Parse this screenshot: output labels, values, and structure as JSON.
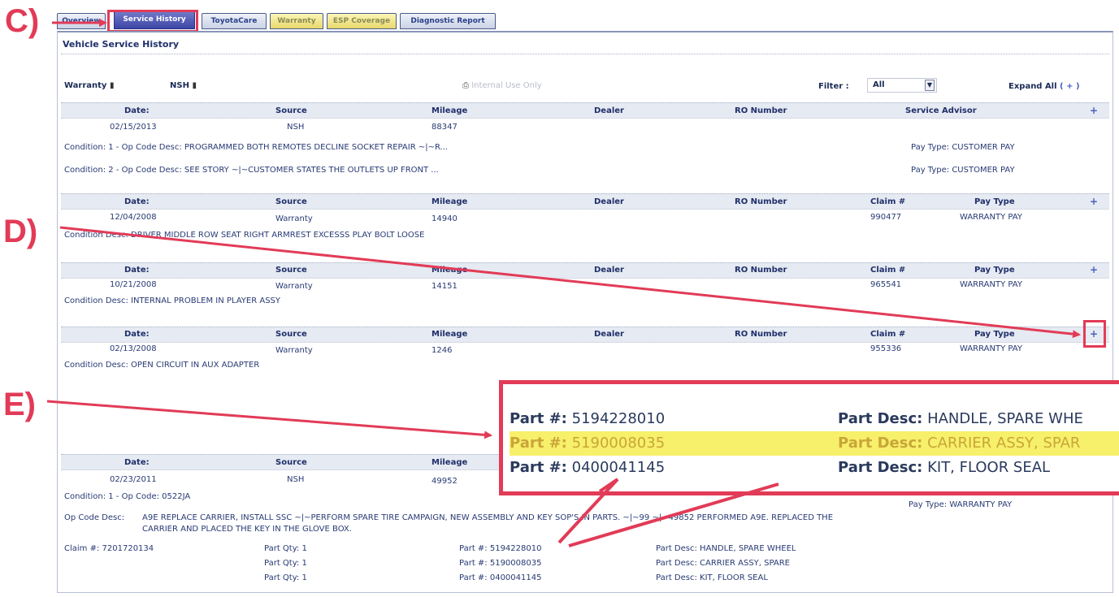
{
  "callouts": {
    "c": "C)",
    "d": "D)",
    "e": "E)"
  },
  "tabs": [
    {
      "label": "Overview",
      "state": "normal"
    },
    {
      "label": "Service History",
      "state": "active"
    },
    {
      "label": "ToyotaCare",
      "state": "normal"
    },
    {
      "label": "Warranty",
      "state": "yellow"
    },
    {
      "label": "ESP Coverage",
      "state": "yellow"
    },
    {
      "label": "Diagnostic Report",
      "state": "normal"
    }
  ],
  "panel_title": "Vehicle Service History",
  "legend": {
    "warranty": "Warranty",
    "nsh": "NSH",
    "center_text": "Internal Use Only"
  },
  "filter": {
    "label": "Filter :",
    "value": "All"
  },
  "expand_all": "Expand All",
  "expand_symbol": "( + )",
  "plus_symbol": "+",
  "column_labels": {
    "date": "Date:",
    "source": "Source",
    "mileage": "Mileage",
    "dealer": "Dealer",
    "ro_number": "RO Number",
    "service_advisor": "Service Advisor",
    "claim": "Claim #",
    "pay_type": "Pay Type"
  },
  "records": [
    {
      "date": "02/15/2013",
      "source": "NSH",
      "mileage": "88347",
      "lines": [
        {
          "text": "Condition: 1 - Op Code Desc: PROGRAMMED BOTH REMOTES DECLINE SOCKET REPAIR ~|~R...",
          "pay": "Pay Type: CUSTOMER PAY"
        },
        {
          "text": "Condition: 2 - Op Code Desc: SEE STORY ~|~CUSTOMER STATES THE OUTLETS UP FRONT ...",
          "pay": "Pay Type: CUSTOMER PAY"
        }
      ]
    },
    {
      "date": "12/04/2008",
      "source": "Warranty",
      "mileage": "14940",
      "claim": "990477",
      "pay_type": "WARRANTY PAY",
      "desc": "Condition Desc: DRIVER MIDDLE ROW SEAT RIGHT ARMREST EXCESSS PLAY BOLT LOOSE"
    },
    {
      "date": "10/21/2008",
      "source": "Warranty",
      "mileage": "14151",
      "claim": "965541",
      "pay_type": "WARRANTY PAY",
      "desc": "Condition Desc: INTERNAL PROBLEM IN PLAYER ASSY"
    },
    {
      "date": "02/13/2008",
      "source": "Warranty",
      "mileage": "1246",
      "claim": "955336",
      "pay_type": "WARRANTY PAY",
      "desc": "Condition Desc: OPEN CIRCUIT IN AUX ADAPTER"
    },
    {
      "date": "02/23/2011",
      "source": "NSH",
      "mileage": "49952",
      "condition": "Condition: 1 - Op Code: 0522JA",
      "pay": "Pay Type: WARRANTY PAY",
      "op_desc_label": "Op Code Desc:",
      "op_desc_line1": "A9E REPLACE CARRIER, INSTALL SSC ~|~PERFORM SPARE TIRE CAMPAIGN, NEW ASSEMBLY AND KEY SOP'S IN PARTS. ~|~99 ~|~49852 PERFORMED A9E. REPLACED THE",
      "op_desc_line2": "CARRIER AND PLACED THE KEY IN THE GLOVE BOX.",
      "claim_line": "Claim #: 7201720134",
      "parts": [
        {
          "qty": "Part Qty: 1",
          "part": "Part #: 5194228010",
          "desc": "Part Desc: HANDLE, SPARE WHEEL"
        },
        {
          "qty": "Part Qty: 1",
          "part": "Part #: 5190008035",
          "desc": "Part Desc: CARRIER ASSY, SPARE"
        },
        {
          "qty": "Part Qty: 1",
          "part": "Part #: 0400041145",
          "desc": "Part Desc: KIT, FLOOR SEAL"
        }
      ]
    }
  ],
  "zoom": {
    "rows": [
      {
        "part_label": "Part #:",
        "part_value": "5194228010",
        "desc_label": "Part Desc:",
        "desc_value": "HANDLE, SPARE WHE"
      },
      {
        "part_label": "Part #:",
        "part_value": "5190008035",
        "desc_label": "Part Desc:",
        "desc_value": "CARRIER ASSY, SPAR"
      },
      {
        "part_label": "Part #:",
        "part_value": "0400041145",
        "desc_label": "Part Desc:",
        "desc_value": "KIT, FLOOR SEAL"
      }
    ]
  },
  "colors": {
    "callout": "#e23b57",
    "highlight": "#f7f06a",
    "active_tab": "#3d46a6"
  }
}
